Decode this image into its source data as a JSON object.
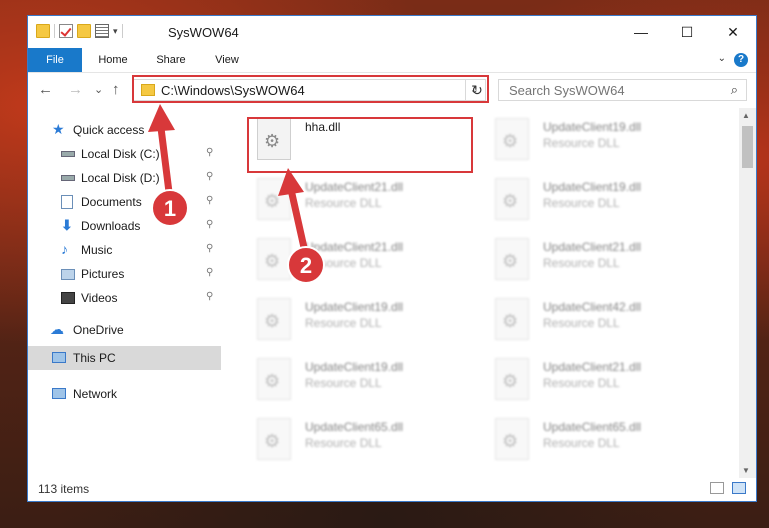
{
  "window": {
    "title": "SysWOW64",
    "controls": {
      "minimize": "—",
      "maximize": "☐",
      "close": "✕"
    }
  },
  "ribbon": {
    "tabs": [
      "File",
      "Home",
      "Share",
      "View"
    ],
    "help": "?"
  },
  "nav": {
    "back_icon": "←",
    "forward_icon": "→",
    "recent_icon": "⌄",
    "up_icon": "↑",
    "address": "C:\\Windows\\SysWOW64",
    "address_dropdown": "⌄",
    "refresh": "↻",
    "search_placeholder": "Search SysWOW64",
    "search_icon": "⌕"
  },
  "sidebar": {
    "items": [
      {
        "label": "Quick access",
        "icon": "star-icon",
        "pinned": false
      },
      {
        "label": "Local Disk (C:)",
        "icon": "drive-icon",
        "pinned": true
      },
      {
        "label": "Local Disk (D:)",
        "icon": "drive-icon",
        "pinned": true
      },
      {
        "label": "Documents",
        "icon": "documents-icon",
        "pinned": true
      },
      {
        "label": "Downloads",
        "icon": "download-icon",
        "pinned": true
      },
      {
        "label": "Music",
        "icon": "music-icon",
        "pinned": true
      },
      {
        "label": "Pictures",
        "icon": "pictures-icon",
        "pinned": true
      },
      {
        "label": "Videos",
        "icon": "videos-icon",
        "pinned": true
      },
      {
        "label": "OneDrive",
        "icon": "cloud-icon",
        "pinned": false
      },
      {
        "label": "This PC",
        "icon": "computer-icon",
        "pinned": false,
        "selected": true
      },
      {
        "label": "Network",
        "icon": "network-icon",
        "pinned": false
      }
    ],
    "pin_glyph": "📌"
  },
  "files": [
    {
      "name": "hha.dll",
      "type": "",
      "highlighted": true
    },
    {
      "name": "UpdateClient19.dll",
      "type": "Resource DLL"
    },
    {
      "name": "UpdateClient21.dll",
      "type": "Resource DLL"
    },
    {
      "name": "UpdateClient19.dll",
      "type": "Resource DLL"
    },
    {
      "name": "UpdateClient21.dll",
      "type": "Resource DLL"
    },
    {
      "name": "UpdateClient21.dll",
      "type": "Resource DLL"
    },
    {
      "name": "UpdateClient19.dll",
      "type": "Resource DLL"
    },
    {
      "name": "UpdateClient42.dll",
      "type": "Resource DLL"
    },
    {
      "name": "UpdateClient19.dll",
      "type": "Resource DLL"
    },
    {
      "name": "UpdateClient21.dll",
      "type": "Resource DLL"
    },
    {
      "name": "UpdateClient65.dll",
      "type": "Resource DLL"
    },
    {
      "name": "UpdateClient65.dll",
      "type": "Resource DLL"
    }
  ],
  "status": {
    "item_count": "113 items"
  },
  "annotations": {
    "step1": "1",
    "step2": "2",
    "color": "#d8383a"
  }
}
